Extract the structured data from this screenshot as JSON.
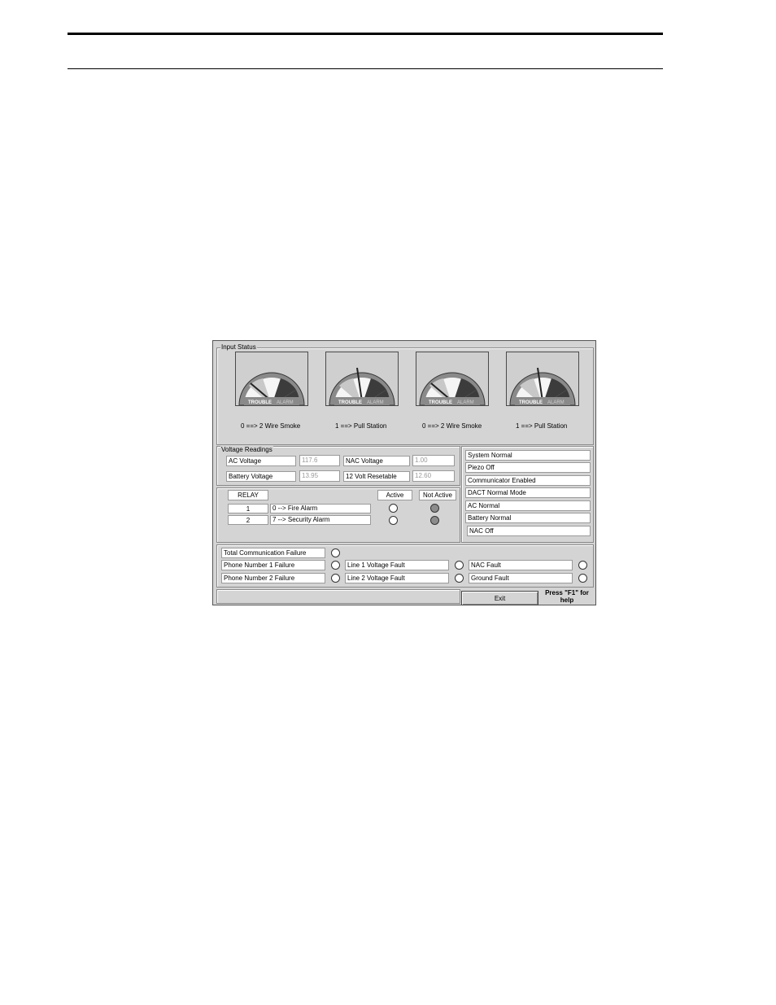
{
  "window": {
    "input_status": {
      "title": "Input Status",
      "gauges": [
        {
          "caption": "0  ==> 2 Wire Smoke",
          "left_label": "TROUBLE",
          "right_label": "ALARM"
        },
        {
          "caption": "1  ==> Pull Station",
          "left_label": "TROUBLE",
          "right_label": "ALARM"
        },
        {
          "caption": "0  ==> 2 Wire Smoke",
          "left_label": "TROUBLE",
          "right_label": "ALARM"
        },
        {
          "caption": "1  ==> Pull Station",
          "left_label": "TROUBLE",
          "right_label": "ALARM"
        }
      ]
    },
    "voltage": {
      "title": "Voltage Readings",
      "ac_label": "AC Voltage",
      "ac_value": "117.6",
      "nac_label": "NAC Voltage",
      "nac_value": "1.00",
      "battery_label": "Battery Voltage",
      "battery_value": "13.95",
      "resettable_label": "12 Volt Resetable",
      "resettable_value": "12.60"
    },
    "relay": {
      "header": "RELAY",
      "active_label": "Active",
      "not_active_label": "Not Active",
      "rows": [
        {
          "num": "1",
          "desc": "0 --> Fire Alarm"
        },
        {
          "num": "2",
          "desc": "7 --> Security Alarm"
        }
      ]
    },
    "status_list": [
      "System Normal",
      "Piezo Off",
      "Communicator Enabled",
      "DACT Normal Mode",
      "AC Normal",
      "Battery Normal",
      "NAC Off"
    ],
    "faults": {
      "total_comm": "Total Communication Failure",
      "phone1": "Phone Number 1 Failure",
      "phone2": "Phone Number 2 Failure",
      "line1": "Line 1 Voltage Fault",
      "line2": "Line 2 Voltage Fault",
      "nac": "NAC Fault",
      "ground": "Ground Fault"
    },
    "footer": {
      "exit_label": "Exit",
      "help_line1": "Press \"F1\" for",
      "help_line2": "help"
    }
  }
}
